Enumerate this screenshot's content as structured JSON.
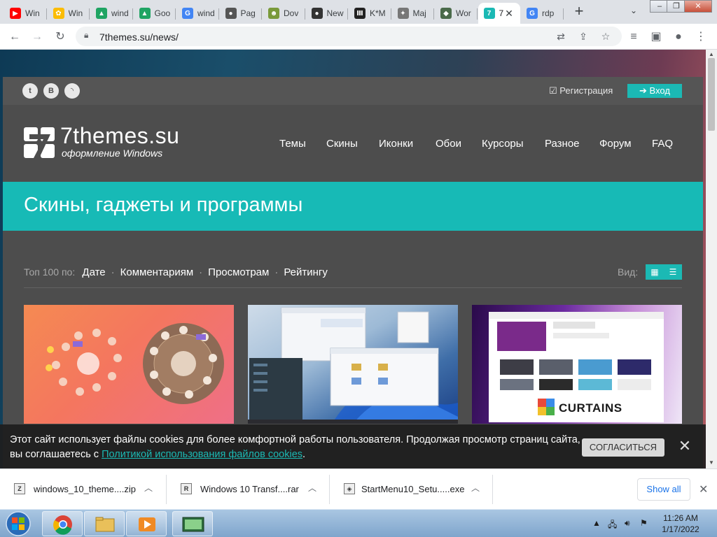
{
  "browser": {
    "tabs": [
      {
        "title": "Win",
        "icon": "youtube-icon",
        "color": "#ff0000",
        "glyph": "▶"
      },
      {
        "title": "Win",
        "icon": "photos-icon",
        "color": "#fbbc04",
        "glyph": "✿"
      },
      {
        "title": "wind",
        "icon": "google-drive-icon",
        "color": "#1fa463",
        "glyph": "▲"
      },
      {
        "title": "Goo",
        "icon": "google-drive-icon",
        "color": "#1fa463",
        "glyph": "▲"
      },
      {
        "title": "wind",
        "icon": "google-icon",
        "color": "#4285f4",
        "glyph": "G"
      },
      {
        "title": "Pag",
        "icon": "site-icon",
        "color": "#555555",
        "glyph": "●"
      },
      {
        "title": "Dov",
        "icon": "site-icon",
        "color": "#7a9a3a",
        "glyph": "☻"
      },
      {
        "title": "New",
        "icon": "github-icon",
        "color": "#333333",
        "glyph": "●"
      },
      {
        "title": "K*M",
        "icon": "site-icon",
        "color": "#222222",
        "glyph": "Ⅲ"
      },
      {
        "title": "Maj",
        "icon": "site-icon",
        "color": "#777777",
        "glyph": "✦"
      },
      {
        "title": "Wor",
        "icon": "site-icon",
        "color": "#4a6a4a",
        "glyph": "◆"
      },
      {
        "title": "7",
        "icon": "7themes-icon",
        "color": "#1bb9b4",
        "glyph": "7",
        "active": true
      },
      {
        "title": "rdp",
        "icon": "google-icon",
        "color": "#4285f4",
        "glyph": "G"
      }
    ],
    "url": "7themes.su/news/"
  },
  "site": {
    "logo_title": "7themes.su",
    "logo_subtitle": "оформление Windows",
    "register": "Регистрация",
    "login": "Вход",
    "social": [
      "twitter",
      "vk",
      "rss"
    ],
    "nav": [
      "Темы",
      "Скины",
      "Иконки",
      "Обои",
      "Курсоры",
      "Разное",
      "Форум",
      "FAQ"
    ],
    "banner_title": "Скины, гаджеты и программы",
    "sort": {
      "label": "Топ 100 по:",
      "options": [
        "Дате",
        "Комментариям",
        "Просмотрам",
        "Рейтингу"
      ]
    },
    "view_label": "Вид:",
    "cards": [
      {
        "name": "weather gadget skin"
      },
      {
        "name": "windows 11 explorer skin"
      },
      {
        "name": "curtains app",
        "caption": "CURTAINS"
      }
    ],
    "accent": "#1bb9b4"
  },
  "cookie": {
    "text": "Этот сайт использует файлы cookies для более комфортной работы пользователя. Продолжая просмотр страниц сайта, вы соглашаетесь с ",
    "link": "Политикой использования файлов cookies",
    "tail": ".",
    "agree": "СОГЛАСИТЬСЯ"
  },
  "downloads": {
    "items": [
      {
        "name": "windows_10_theme....zip",
        "icon": "zip-icon",
        "glyph": "Z"
      },
      {
        "name": "Windows 10 Transf....rar",
        "icon": "rar-icon",
        "glyph": "R"
      },
      {
        "name": "StartMenu10_Setu.....exe",
        "icon": "exe-icon",
        "glyph": "◈"
      }
    ],
    "show_all": "Show all"
  },
  "taskbar": {
    "time": "11:26 AM",
    "date": "1/17/2022"
  }
}
